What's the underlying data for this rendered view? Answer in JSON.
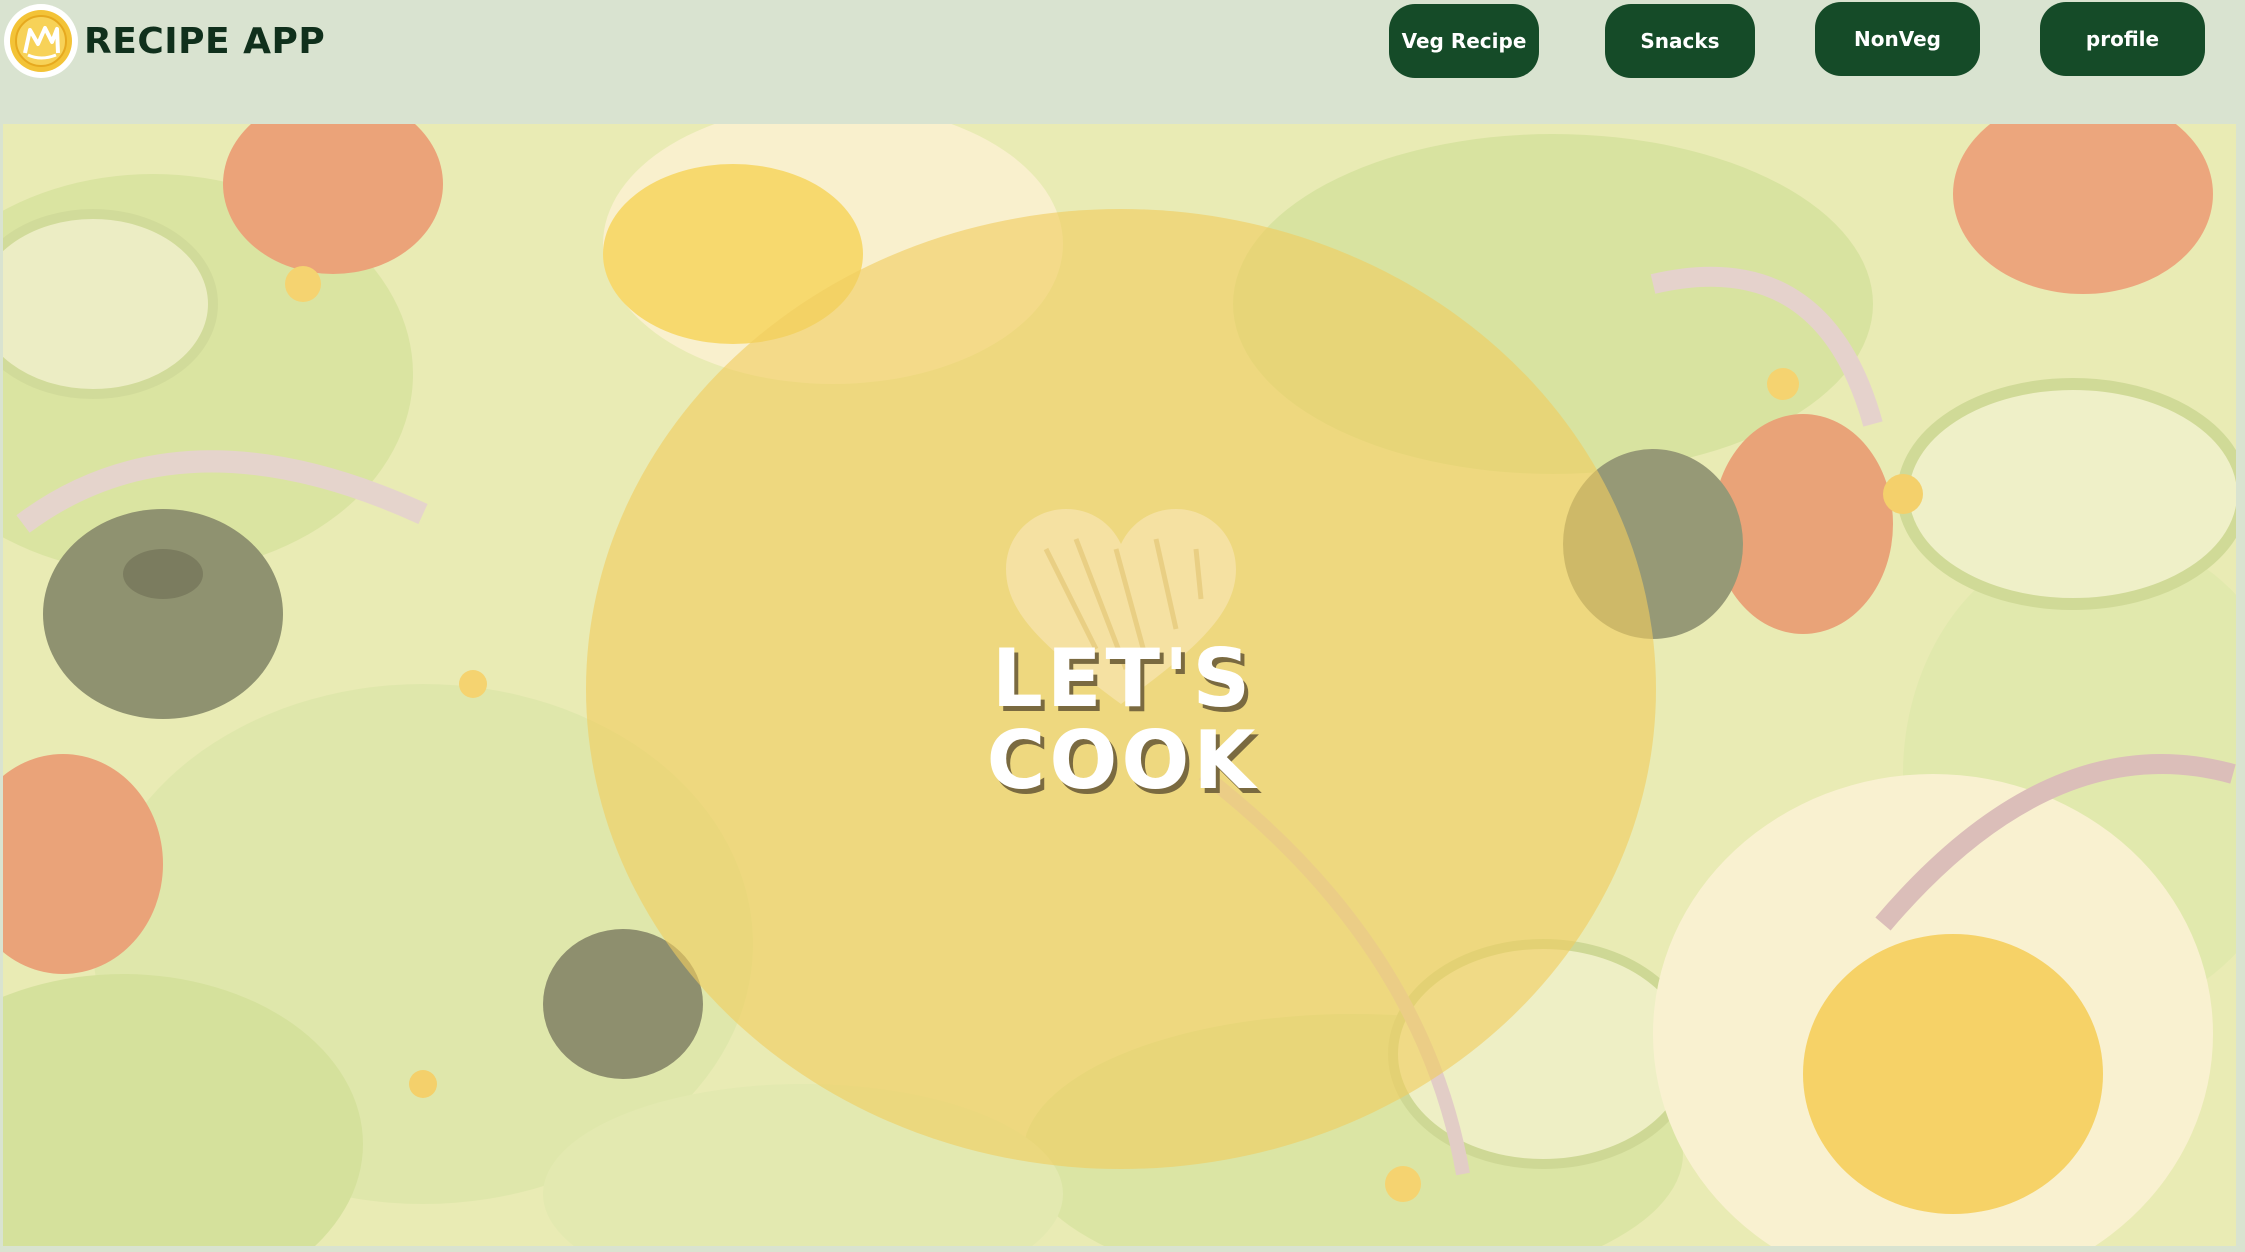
{
  "app": {
    "title": "RECIPE APP"
  },
  "nav": {
    "items": [
      {
        "id": "veg",
        "label": "Veg Recipe"
      },
      {
        "id": "snacks",
        "label": "Snacks"
      },
      {
        "id": "nonveg",
        "label": "NonVeg"
      },
      {
        "id": "profile",
        "label": "profile"
      }
    ]
  },
  "hero": {
    "emblem_line1": "LET'S",
    "emblem_line2": "COOK"
  },
  "colors": {
    "navbar_bg": "#d9e3d0",
    "button_bg": "#154b28",
    "button_text": "#ffffff",
    "title_text": "#10301c",
    "emblem_fill": "#f0cd5f"
  },
  "icons": {
    "logo": "chef-logo-icon",
    "emblem": "heart-icon"
  }
}
